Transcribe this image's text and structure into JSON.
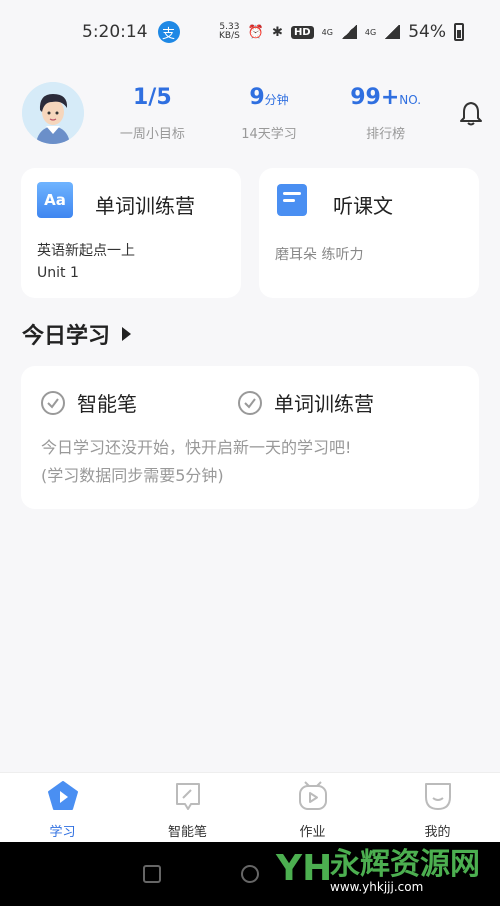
{
  "status_bar": {
    "time": "5:20:14",
    "app_badge": "支",
    "net_speed_value": "5.33",
    "net_speed_unit": "KB/S",
    "hd": "HD",
    "net_type_1": "4G",
    "net_type_2": "4G",
    "battery": "54%"
  },
  "header": {
    "stats": [
      {
        "value": "1/5",
        "unit": "",
        "label": "一周小目标"
      },
      {
        "value": "9",
        "unit": "分钟",
        "label": "14天学习"
      },
      {
        "value": "99+",
        "unit": "NO.",
        "label": "排行榜"
      }
    ]
  },
  "cards": {
    "vocab": {
      "title": "单词训练营",
      "line1": "英语新起点一上",
      "line2": "Unit 1",
      "icon_text": "Aa"
    },
    "listen": {
      "title": "听课文",
      "line1": "磨耳朵 练听力"
    }
  },
  "today": {
    "title": "今日学习",
    "items": [
      "智能笔",
      "单词训练营"
    ],
    "msg_line1": "今日学习还没开始，快开启新一天的学习吧!",
    "msg_line2": "(学习数据同步需要5分钟)"
  },
  "tabbar": {
    "tabs": [
      {
        "label": "学习",
        "active": true
      },
      {
        "label": "智能笔",
        "active": false
      },
      {
        "label": "作业",
        "active": false
      },
      {
        "label": "我的",
        "active": false
      }
    ]
  },
  "watermark": {
    "logo": "YH",
    "text": "永辉资源网",
    "url": "www.yhkjjj.com"
  },
  "colors": {
    "accent": "#2f6fe0",
    "background": "#f7f7f9",
    "card": "#ffffff"
  }
}
